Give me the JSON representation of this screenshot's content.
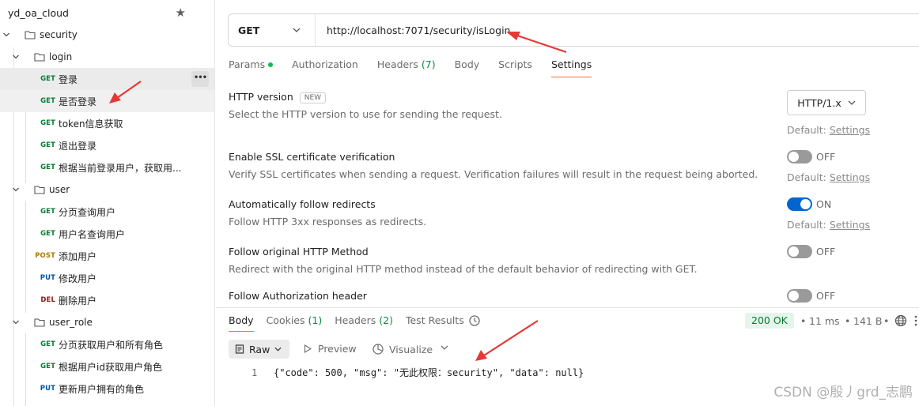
{
  "sidebar": {
    "title": "yd_oa_cloud",
    "tree": [
      {
        "type": "folder",
        "label": "security",
        "depth": 0
      },
      {
        "type": "folder",
        "label": "login",
        "depth": 1
      },
      {
        "type": "request",
        "method": "GET",
        "label": "登录",
        "depth": 2,
        "selected": true
      },
      {
        "type": "request",
        "method": "GET",
        "label": "是否登录",
        "depth": 2,
        "selected": true
      },
      {
        "type": "request",
        "method": "GET",
        "label": "token信息获取",
        "depth": 2
      },
      {
        "type": "request",
        "method": "GET",
        "label": "退出登录",
        "depth": 2
      },
      {
        "type": "request",
        "method": "GET",
        "label": "根据当前登录用户，获取用...",
        "depth": 2
      },
      {
        "type": "folder",
        "label": "user",
        "depth": 1
      },
      {
        "type": "request",
        "method": "GET",
        "label": "分页查询用户",
        "depth": 2
      },
      {
        "type": "request",
        "method": "GET",
        "label": "用户名查询用户",
        "depth": 2
      },
      {
        "type": "request",
        "method": "POST",
        "label": "添加用户",
        "depth": 2
      },
      {
        "type": "request",
        "method": "PUT",
        "label": "修改用户",
        "depth": 2
      },
      {
        "type": "request",
        "method": "DEL",
        "label": "删除用户",
        "depth": 2
      },
      {
        "type": "folder",
        "label": "user_role",
        "depth": 1
      },
      {
        "type": "request",
        "method": "GET",
        "label": "分页获取用户和所有角色",
        "depth": 2
      },
      {
        "type": "request",
        "method": "GET",
        "label": "根据用户id获取用户角色",
        "depth": 2
      },
      {
        "type": "request",
        "method": "PUT",
        "label": "更新用户拥有的角色",
        "depth": 2
      }
    ],
    "more_label": "•••"
  },
  "request": {
    "method": "GET",
    "url": "http://localhost:7071/security/isLogin"
  },
  "request_tabs": [
    {
      "label": "Params",
      "dot": true
    },
    {
      "label": "Authorization"
    },
    {
      "label": "Headers",
      "count": "(7)"
    },
    {
      "label": "Body"
    },
    {
      "label": "Scripts"
    },
    {
      "label": "Settings",
      "active": true
    }
  ],
  "settings": {
    "http_version": {
      "title": "HTTP version",
      "badge": "NEW",
      "desc": "Select the HTTP version to use for sending the request.",
      "value": "HTTP/1.x",
      "default_prefix": "Default: ",
      "default_link": "Settings"
    },
    "ssl": {
      "title": "Enable SSL certificate verification",
      "desc": "Verify SSL certificates when sending a request. Verification failures will result in the request being aborted.",
      "state": "OFF",
      "default_prefix": "Default: ",
      "default_link": "Settings"
    },
    "redirects": {
      "title": "Automatically follow redirects",
      "desc": "Follow HTTP 3xx responses as redirects.",
      "state": "ON",
      "default_prefix": "Default: ",
      "default_link": "Settings"
    },
    "original_method": {
      "title": "Follow original HTTP Method",
      "desc": "Redirect with the original HTTP method instead of the default behavior of redirecting with GET.",
      "state": "OFF"
    },
    "auth_header": {
      "title": "Follow Authorization header",
      "state": "OFF"
    }
  },
  "response": {
    "tabs": [
      {
        "label": "Body",
        "active": true
      },
      {
        "label": "Cookies",
        "count": "(1)"
      },
      {
        "label": "Headers",
        "count": "(2)"
      },
      {
        "label": "Test Results"
      }
    ],
    "status": "200 OK",
    "time": "11 ms",
    "size": "141 B",
    "sep": "•",
    "format": "Raw",
    "preview_label": "Preview",
    "visualize_label": "Visualize",
    "line_number": "1",
    "body": "{\"code\": 500, \"msg\": \"无此权限：security\", \"data\": null}"
  },
  "watermark": "CSDN @殷丿grd_志鹏",
  "colors": {
    "accent_tab": "#ff6c37",
    "toggle_on": "#0265d2",
    "status_ok_bg": "#e4f6ea",
    "annotation_arrow": "#e53935"
  }
}
